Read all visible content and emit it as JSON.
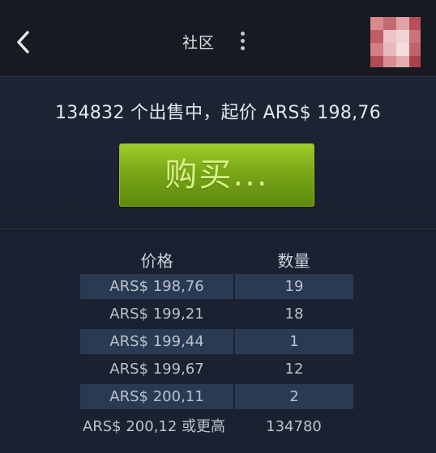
{
  "header": {
    "title": "社区",
    "back_icon": "chevron-left-icon",
    "menu_icon": "more-vertical-icon"
  },
  "listing": {
    "summary": "134832 个出售中，起价 ARS$ 198,76",
    "buy_label": "购买..."
  },
  "orders": {
    "columns": [
      "价格",
      "数量"
    ],
    "rows": [
      {
        "price": "ARS$ 198,76",
        "qty": "19"
      },
      {
        "price": "ARS$ 199,21",
        "qty": "18"
      },
      {
        "price": "ARS$ 199,44",
        "qty": "1"
      },
      {
        "price": "ARS$ 199,67",
        "qty": "12"
      },
      {
        "price": "ARS$ 200,11",
        "qty": "2"
      },
      {
        "price": "ARS$ 200,12 或更高",
        "qty": "134780"
      }
    ]
  },
  "colors": {
    "buy_button": "#7aa619",
    "row_highlight": "#2a3a52",
    "background": "#1b2130"
  }
}
